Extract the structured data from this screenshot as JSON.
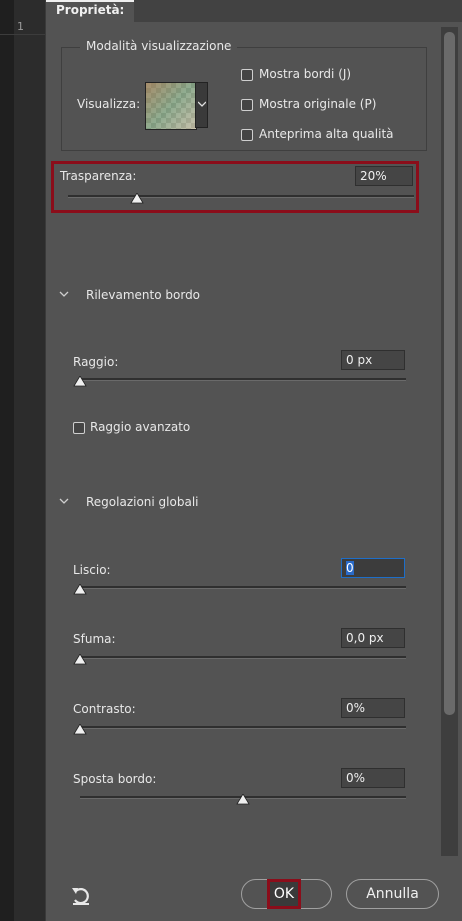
{
  "ruler": {
    "number": "1"
  },
  "panel": {
    "tab_title": "Proprietà:"
  },
  "view_mode": {
    "legend": "Modalità visualizzazione",
    "view_label": "Visualizza:",
    "show_edges": "Mostra bordi (J)",
    "show_original": "Mostra originale (P)",
    "high_quality_preview": "Anteprima alta qualità"
  },
  "transparency": {
    "label": "Trasparenza:",
    "value": "20%",
    "level": 0.2
  },
  "edge_detection": {
    "title": "Rilevamento bordo",
    "radius_label": "Raggio:",
    "radius_value": "0 px",
    "radius_level": 0,
    "smart_radius": "Raggio avanzato"
  },
  "global_adjustments": {
    "title": "Regolazioni globali",
    "smooth_label": "Liscio:",
    "smooth_value": "0",
    "smooth_level": 0,
    "feather_label": "Sfuma:",
    "feather_value": "0,0 px",
    "feather_level": 0,
    "contrast_label": "Contrasto:",
    "contrast_value": "0%",
    "contrast_level": 0,
    "shift_edge_label": "Sposta bordo:",
    "shift_edge_value": "0%",
    "shift_edge_level": 0.5
  },
  "buttons": {
    "ok": "OK",
    "cancel": "Annulla"
  },
  "icons": {
    "reset": "reset-arrow-icon",
    "dropdown": "chevron-down-icon",
    "section": "chevron-down-icon",
    "slider": "triangle-thumb-icon"
  },
  "colors": {
    "highlight": "#8b0d1a",
    "focus": "#1e6ec8",
    "panel": "#535353"
  }
}
